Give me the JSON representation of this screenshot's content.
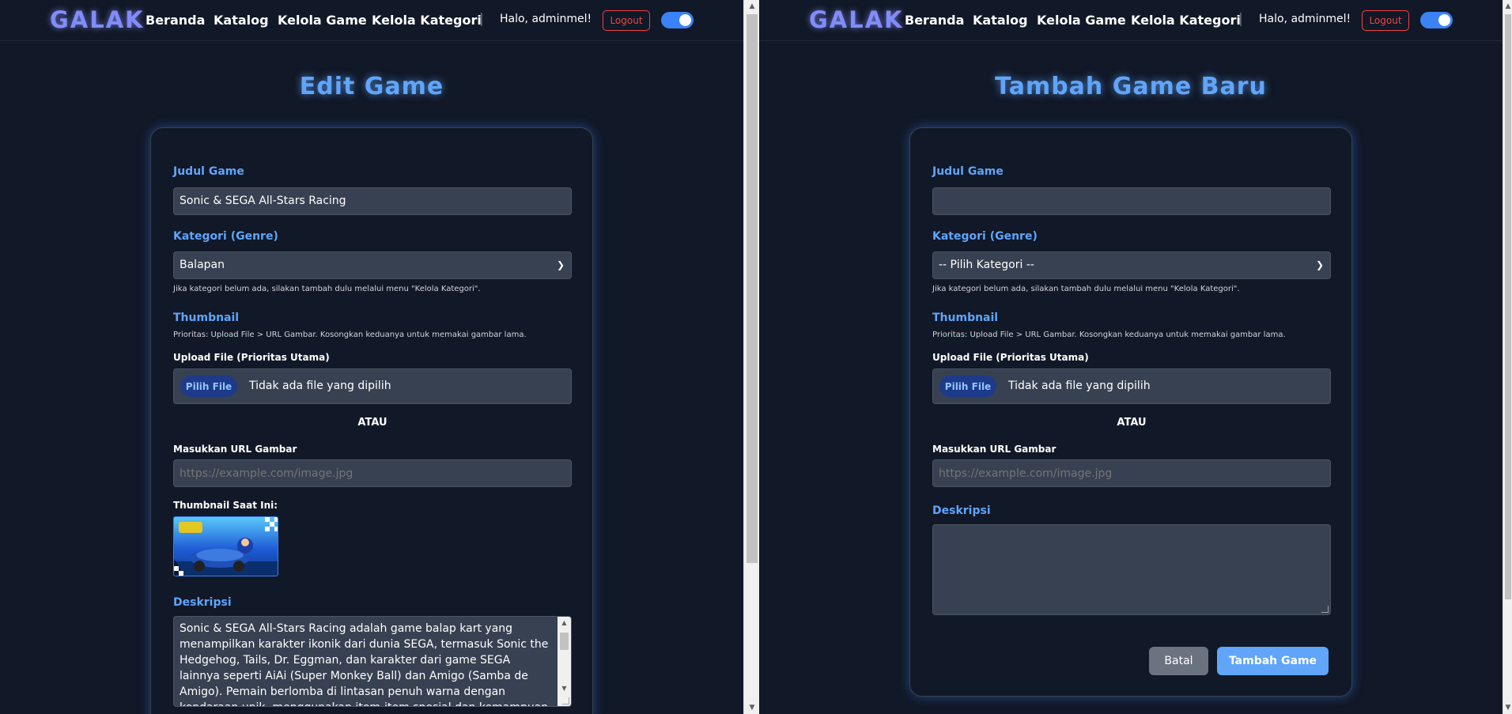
{
  "navbar": {
    "logo": "GALAK",
    "links": [
      "Beranda",
      "Katalog",
      "Kelola Game",
      "Kelola Kategori"
    ],
    "separator": "|",
    "greeting": "Halo, adminmel!",
    "logout_label": "Logout",
    "dark_mode": true
  },
  "edit_form": {
    "title": "Edit Game",
    "judul_label": "Judul Game",
    "judul_value": "Sonic & SEGA All-Stars Racing",
    "kategori_label": "Kategori (Genre)",
    "kategori_value": "Balapan",
    "kategori_hint": "Jika kategori belum ada, silakan tambah dulu melalui menu \"Kelola Kategori\".",
    "thumbnail_label": "Thumbnail",
    "thumbnail_hint": "Prioritas: Upload File > URL Gambar. Kosongkan keduanya untuk memakai gambar lama.",
    "upload_label": "Upload File (Prioritas Utama)",
    "file_button": "Pilih File",
    "file_status": "Tidak ada file yang dipilih",
    "atau": "ATAU",
    "url_label": "Masukkan URL Gambar",
    "url_placeholder": "https://example.com/image.jpg",
    "current_thumb_label": "Thumbnail Saat Ini:",
    "deskripsi_label": "Deskripsi",
    "deskripsi_value": "Sonic & SEGA All-Stars Racing adalah game balap kart yang menampilkan karakter ikonik dari dunia SEGA, termasuk Sonic the Hedgehog, Tails, Dr. Eggman, dan karakter dari game SEGA lainnya seperti AiAi (Super Monkey Ball) dan Amigo (Samba de Amigo). Pemain berlomba di lintasan penuh warna dengan kendaraan unik, menggunakan item-item spesial dan kemampuan unik masing-masing karakter."
  },
  "add_form": {
    "title": "Tambah Game Baru",
    "judul_label": "Judul Game",
    "judul_value": "",
    "kategori_label": "Kategori (Genre)",
    "kategori_value": "-- Pilih Kategori --",
    "kategori_hint": "Jika kategori belum ada, silakan tambah dulu melalui menu \"Kelola Kategori\".",
    "thumbnail_label": "Thumbnail",
    "thumbnail_hint": "Prioritas: Upload File > URL Gambar. Kosongkan keduanya untuk memakai gambar lama.",
    "upload_label": "Upload File (Prioritas Utama)",
    "file_button": "Pilih File",
    "file_status": "Tidak ada file yang dipilih",
    "atau": "ATAU",
    "url_label": "Masukkan URL Gambar",
    "url_placeholder": "https://example.com/image.jpg",
    "deskripsi_label": "Deskripsi",
    "deskripsi_value": "",
    "cancel_label": "Batal",
    "submit_label": "Tambah Game"
  },
  "colors": {
    "background": "#111827",
    "accent": "#60a5fa",
    "logo": "#818cf8",
    "logout": "#ef4444",
    "field": "#374151"
  }
}
